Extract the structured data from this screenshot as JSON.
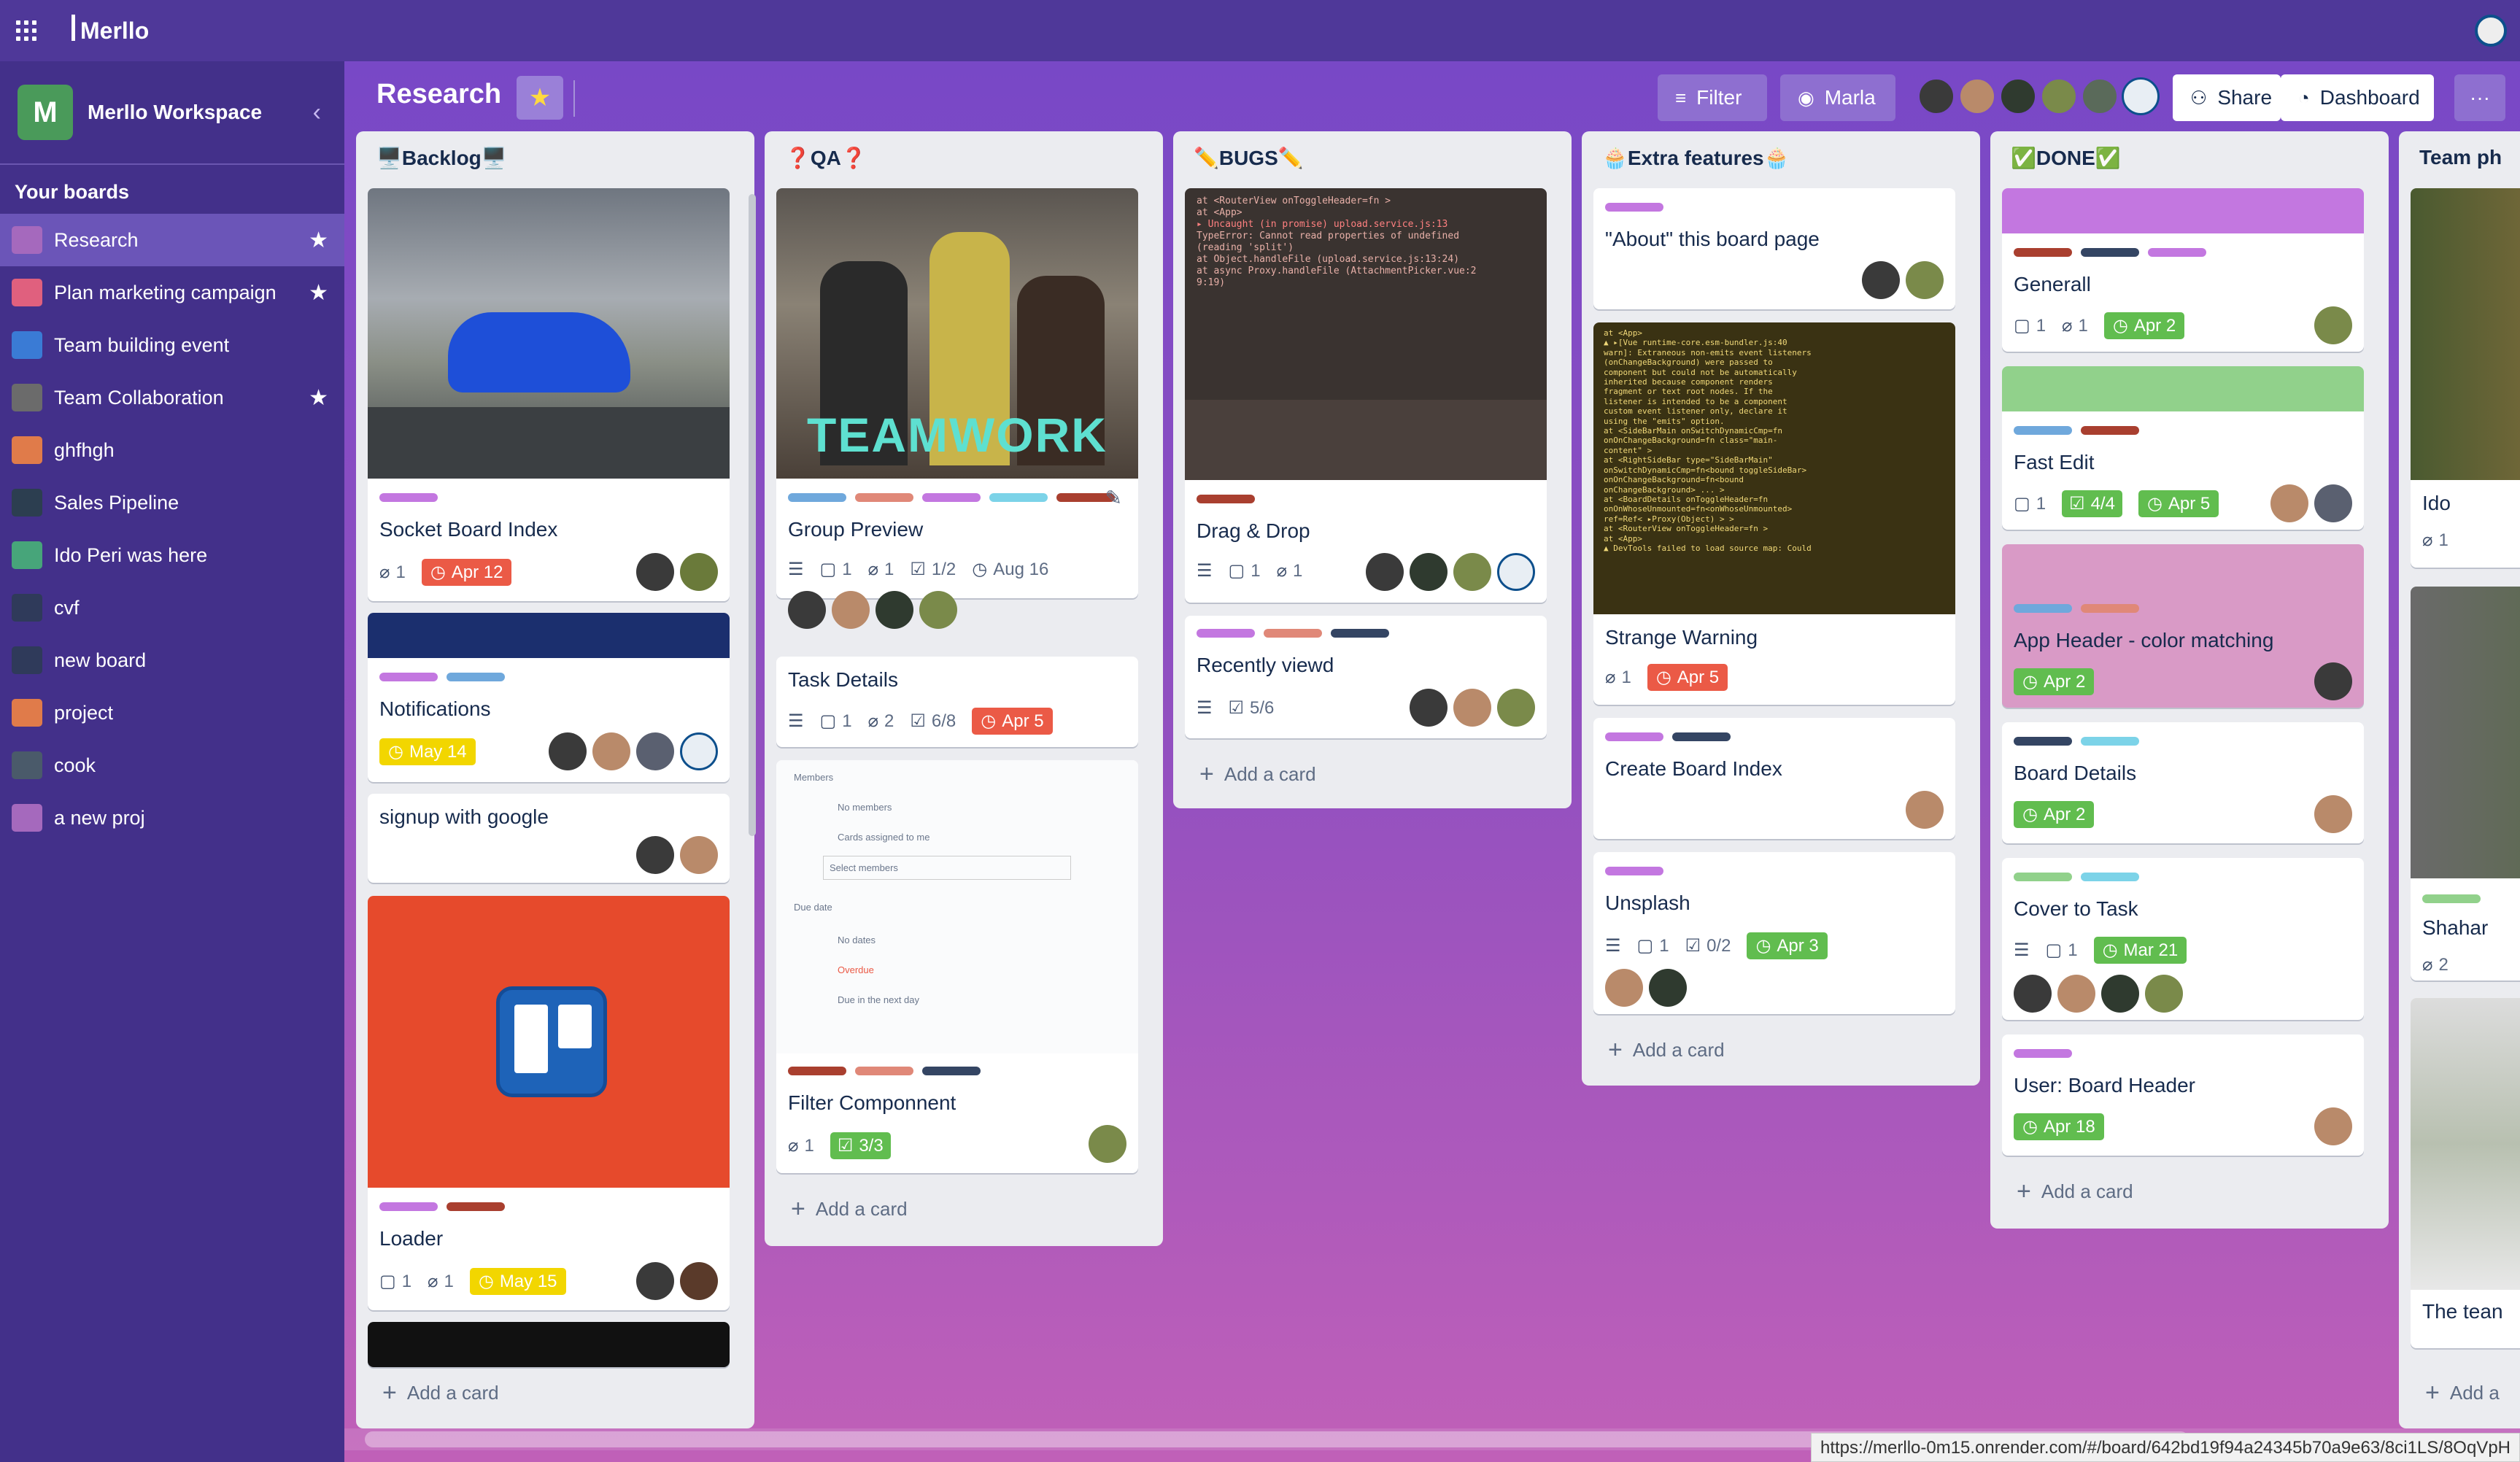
{
  "app": {
    "name": "Merllo"
  },
  "workspace": {
    "initial": "M",
    "name": "Merllo Workspace"
  },
  "sidebar": {
    "heading": "Your boards",
    "items": [
      {
        "label": "Research",
        "color": "#a569bd",
        "starred": true,
        "active": true
      },
      {
        "label": "Plan marketing campaign",
        "color": "#e0607e",
        "starred": true
      },
      {
        "label": "Team building event",
        "color": "#3a7bd5",
        "starred": false
      },
      {
        "label": "Team Collaboration",
        "color": "#6b6b6b",
        "starred": true
      },
      {
        "label": "ghfhgh",
        "color": "#e07b4a",
        "starred": false
      },
      {
        "label": "Sales Pipeline",
        "color": "#2c3e50",
        "starred": false
      },
      {
        "label": "Ido Peri was here",
        "color": "#47a57a",
        "starred": false
      },
      {
        "label": "cvf",
        "color": "#2f3a5a",
        "starred": false
      },
      {
        "label": "new board",
        "color": "#2f3a5a",
        "starred": false
      },
      {
        "label": "project",
        "color": "#e07b4a",
        "starred": false
      },
      {
        "label": "cook",
        "color": "#4a5a6a",
        "starred": false
      },
      {
        "label": "a new proj",
        "color": "#a569bd",
        "starred": false
      }
    ],
    "star_glyph": "★"
  },
  "board": {
    "title": "Research",
    "star_glyph": "★",
    "filter_label": "Filter",
    "member_filter_label": "Marla",
    "share_label": "Share",
    "dashboard_label": "Dashboard",
    "more_glyph": "···"
  },
  "colors": {
    "lbl_purple": "#c377e0",
    "lbl_blue": "#6fa8dc",
    "lbl_red": "#a93f2f",
    "lbl_salmon": "#e08878",
    "lbl_dark": "#344563",
    "lbl_cyan": "#7cd3e8",
    "lbl_green": "#91d18b",
    "lbl_pink": "#d99ac6",
    "due_red": "#eb5a46",
    "due_green": "#61bd4f",
    "due_yellow": "#f2d600"
  },
  "lists": [
    {
      "title": "🖥️Backlog🖥️",
      "cards": [
        {
          "title": "Socket Board Index",
          "attachments": "1",
          "due": "Apr 12"
        },
        {
          "title": "Notifications",
          "due": "May 14"
        },
        {
          "title": "signup with google"
        },
        {
          "title": "Loader",
          "comments": "1",
          "attachments": "1",
          "due": "May 15"
        }
      ],
      "add_label": "Add a card"
    },
    {
      "title": "❓QA❓",
      "cards": [
        {
          "title": "Group Preview",
          "cover_text": "TEAMWORK",
          "comments": "1",
          "attachments": "1",
          "checklist": "1/2",
          "due": "Aug 16"
        },
        {
          "title": "Task Details",
          "comments": "1",
          "attachments": "2",
          "checklist": "6/8",
          "due": "Apr 5"
        },
        {
          "title": "Filter Componnent",
          "attachments": "1",
          "checklist": "3/3",
          "cover_lines": [
            "Members",
            "No members",
            "Cards assigned to me",
            "Select members",
            "Due date",
            "No dates",
            "Overdue",
            "Due in the next day"
          ]
        }
      ],
      "add_label": "Add a card"
    },
    {
      "title": "✏️BUGS✏️",
      "cards": [
        {
          "title": "Drag & Drop",
          "comments": "1",
          "attachments": "1",
          "cover_lines": [
            "at <RouterView onToggleHeader=fn >",
            "at <App>",
            "▸ Uncaught (in promise)   upload.service.js:13",
            "TypeError: Cannot read properties of undefined",
            "(reading 'split')",
            "    at Object.handleFile (upload.service.js:13:24)",
            "    at async Proxy.handleFile (AttachmentPicker.vue:2",
            "9:19)"
          ]
        },
        {
          "title": "Recently viewd",
          "checklist": "5/6"
        }
      ],
      "add_label": "Add a card"
    },
    {
      "title": "🧁Extra features🧁",
      "cards": [
        {
          "title": "\"About\" this board page"
        },
        {
          "title": "Strange Warning",
          "attachments": "1",
          "due": "Apr 5",
          "cover_lines": [
            "  at <App>",
            "▲ ▸[Vue    runtime-core.esm-bundler.js:40",
            "warn]: Extraneous non-emits event listeners",
            "(onChangeBackground) were passed to",
            "component but could not be automatically",
            "inherited because component renders",
            "fragment or text root nodes. If the",
            "listener is intended to be a component",
            "custom event listener only, declare it",
            "using the \"emits\" option.",
            "  at <SideBarMain onSwitchDynamicCmp=fn",
            "onOnChangeBackground=fn class=\"main-",
            "content\" >",
            "  at <RightSideBar type=\"SideBarMain\"",
            "onSwitchDynamicCmp=fn<bound toggleSideBar>",
            "onOnChangeBackground=fn<bound",
            "onChangeBackground> ... >",
            "  at <BoardDetails onToggleHeader=fn",
            "onOnWhoseUnmounted=fn<onWhoseUnmounted>",
            "ref=Ref< ▸Proxy(Object) > >",
            "  at <RouterView onToggleHeader=fn >",
            "  at <App>",
            "▲ DevTools failed to load source map: Could"
          ]
        },
        {
          "title": "Create Board Index"
        },
        {
          "title": "Unsplash",
          "comments": "1",
          "checklist": "0/2",
          "due": "Apr 3"
        }
      ],
      "add_label": "Add a card"
    },
    {
      "title": "✅DONE✅",
      "cards": [
        {
          "title": "Generall",
          "comments": "1",
          "attachments": "1",
          "due": "Apr 2"
        },
        {
          "title": "Fast Edit",
          "comments": "1",
          "checklist": "4/4",
          "due": "Apr 5"
        },
        {
          "title": "App Header - color matching",
          "due": "Apr 2"
        },
        {
          "title": "Board Details",
          "due": "Apr 2"
        },
        {
          "title": "Cover to Task",
          "comments": "1",
          "due": "Mar 21"
        },
        {
          "title": "User: Board Header",
          "due": "Apr 18"
        }
      ],
      "add_label": "Add a card"
    },
    {
      "title": "Team ph",
      "cards": [
        {
          "title": "Ido",
          "attachments": "1"
        },
        {
          "title": "Shahar",
          "attachments": "2"
        },
        {
          "title": "The tean"
        }
      ],
      "add_label": "Add a"
    }
  ],
  "icons": {
    "attachment": "📎",
    "comment": "💬",
    "checklist": "☑",
    "clock": "◷",
    "description": "☰",
    "plus": "+",
    "edit": "✎"
  },
  "status_url": "https://merllo-0m15.onrender.com/#/board/642bd19f94a24345b70a9e63/8ci1LS/8OqVpH"
}
